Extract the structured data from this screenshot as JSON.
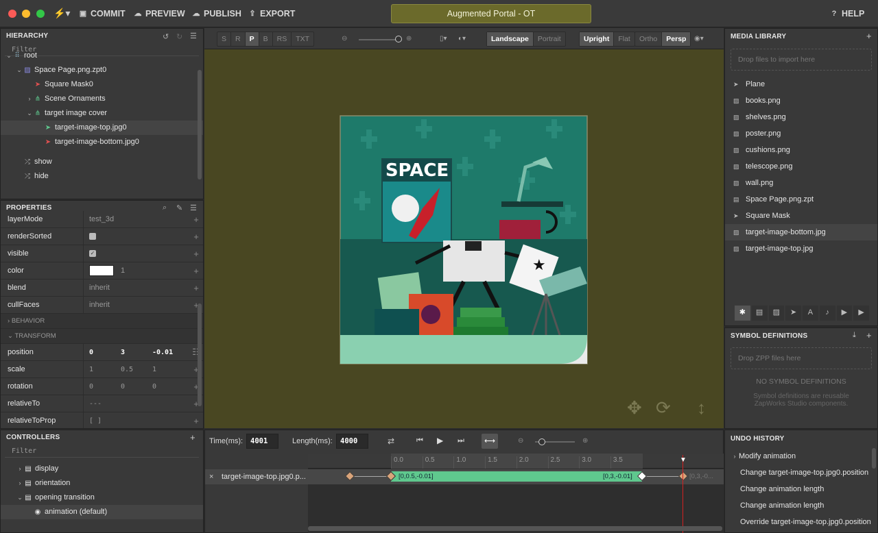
{
  "toolbar": {
    "commit": "COMMIT",
    "preview": "PREVIEW",
    "publish": "PUBLISH",
    "export": "EXPORT",
    "title": "Augmented Portal - OT",
    "help": "HELP"
  },
  "hierarchy": {
    "title": "HIERARCHY",
    "filter": "Filter",
    "items": [
      {
        "label": "root",
        "indent": 0,
        "icon": "root-icon",
        "caret": "down"
      },
      {
        "label": "Space Page.png.zpt0",
        "indent": 1,
        "icon": "image-icon",
        "caret": "down"
      },
      {
        "label": "Square Mask0",
        "indent": 2,
        "icon": "plane-icon",
        "caret": ""
      },
      {
        "label": "Scene Ornaments",
        "indent": 2,
        "icon": "group-icon",
        "caret": "right"
      },
      {
        "label": "target image cover",
        "indent": 2,
        "icon": "group-icon",
        "caret": "down"
      },
      {
        "label": "target-image-top.jpg0",
        "indent": 3,
        "icon": "plane-icon",
        "caret": "",
        "selected": true
      },
      {
        "label": "target-image-bottom.jpg0",
        "indent": 3,
        "icon": "plane-icon",
        "caret": ""
      },
      {
        "label": "show",
        "indent": 1,
        "icon": "shuffle-icon",
        "caret": ""
      },
      {
        "label": "hide",
        "indent": 1,
        "icon": "shuffle-icon",
        "caret": ""
      }
    ]
  },
  "properties": {
    "title": "PROPERTIES",
    "rows": [
      {
        "label": "layerMode",
        "value": "test_3d"
      },
      {
        "label": "renderSorted",
        "value": "",
        "check": "off"
      },
      {
        "label": "visible",
        "value": "",
        "check": "on"
      },
      {
        "label": "color",
        "value": "1",
        "swatch": true
      },
      {
        "label": "blend",
        "value": "inherit"
      },
      {
        "label": "cullFaces",
        "value": "inherit"
      }
    ],
    "behavior": "BEHAVIOR",
    "transform": "TRANSFORM",
    "transform_rows": [
      {
        "label": "position",
        "v": [
          "0",
          "3",
          "-0.01"
        ],
        "active": true
      },
      {
        "label": "scale",
        "v": [
          "1",
          "0.5",
          "1"
        ]
      },
      {
        "label": "rotation",
        "v": [
          "0",
          "0",
          "0"
        ]
      },
      {
        "label": "relativeTo",
        "v": [
          "---",
          "",
          ""
        ]
      },
      {
        "label": "relativeToProp",
        "v": [
          "[ ]",
          "",
          ""
        ]
      }
    ]
  },
  "controllers": {
    "title": "CONTROLLERS",
    "filter": "Filter",
    "items": [
      {
        "label": "display",
        "indent": 1,
        "caret": "right"
      },
      {
        "label": "orientation",
        "indent": 1,
        "caret": "right"
      },
      {
        "label": "opening transition",
        "indent": 1,
        "caret": "down"
      },
      {
        "label": "animation (default)",
        "indent": 2,
        "caret": "",
        "selected": true
      }
    ]
  },
  "viewport": {
    "modes": [
      "S",
      "R",
      "P",
      "B",
      "RS",
      "TXT"
    ],
    "active_mode": "P",
    "orient": [
      "Landscape",
      "Portrait"
    ],
    "upright": [
      "Upright",
      "Flat"
    ],
    "proj": [
      "Ortho",
      "Persp"
    ],
    "poster_text": "SPACE"
  },
  "media": {
    "title": "MEDIA LIBRARY",
    "drop": "Drop files to import here",
    "items": [
      {
        "label": "Plane",
        "icon": "plane-icon"
      },
      {
        "label": "books.png",
        "icon": "image-icon"
      },
      {
        "label": "shelves.png",
        "icon": "image-icon"
      },
      {
        "label": "poster.png",
        "icon": "image-icon"
      },
      {
        "label": "cushions.png",
        "icon": "image-icon"
      },
      {
        "label": "telescope.png",
        "icon": "image-icon"
      },
      {
        "label": "wall.png",
        "icon": "image-icon"
      },
      {
        "label": "Space Page.png.zpt",
        "icon": "file-icon"
      },
      {
        "label": "Square Mask",
        "icon": "plane-icon"
      },
      {
        "label": "target-image-bottom.jpg",
        "icon": "image-icon",
        "selected": true
      },
      {
        "label": "target-image-top.jpg",
        "icon": "image-icon"
      }
    ]
  },
  "symbols": {
    "title": "SYMBOL DEFINITIONS",
    "drop": "Drop ZPP files here",
    "empty": "NO SYMBOL DEFINITIONS",
    "desc1": "Symbol definitions are reusable",
    "desc2": "ZapWorks Studio components."
  },
  "timeline": {
    "time_label": "Time(ms):",
    "time": "4001",
    "length_label": "Length(ms):",
    "length": "4000",
    "ticks": [
      "0.0",
      "0.5",
      "1.0",
      "1.5",
      "2.0",
      "2.5",
      "3.0",
      "3.5"
    ],
    "track": "target-image-top.jpg0.p...",
    "kf_start": "[0,0.5,-0.01]",
    "kf_end": "[0,3,-0.01]",
    "kf_after": "[0,3,-0..."
  },
  "undo": {
    "title": "UNDO HISTORY",
    "items": [
      "Modify animation",
      "Change target-image-top.jpg0.position",
      "Change animation length",
      "Change animation length",
      "Override target-image-top.jpg0.position"
    ]
  }
}
